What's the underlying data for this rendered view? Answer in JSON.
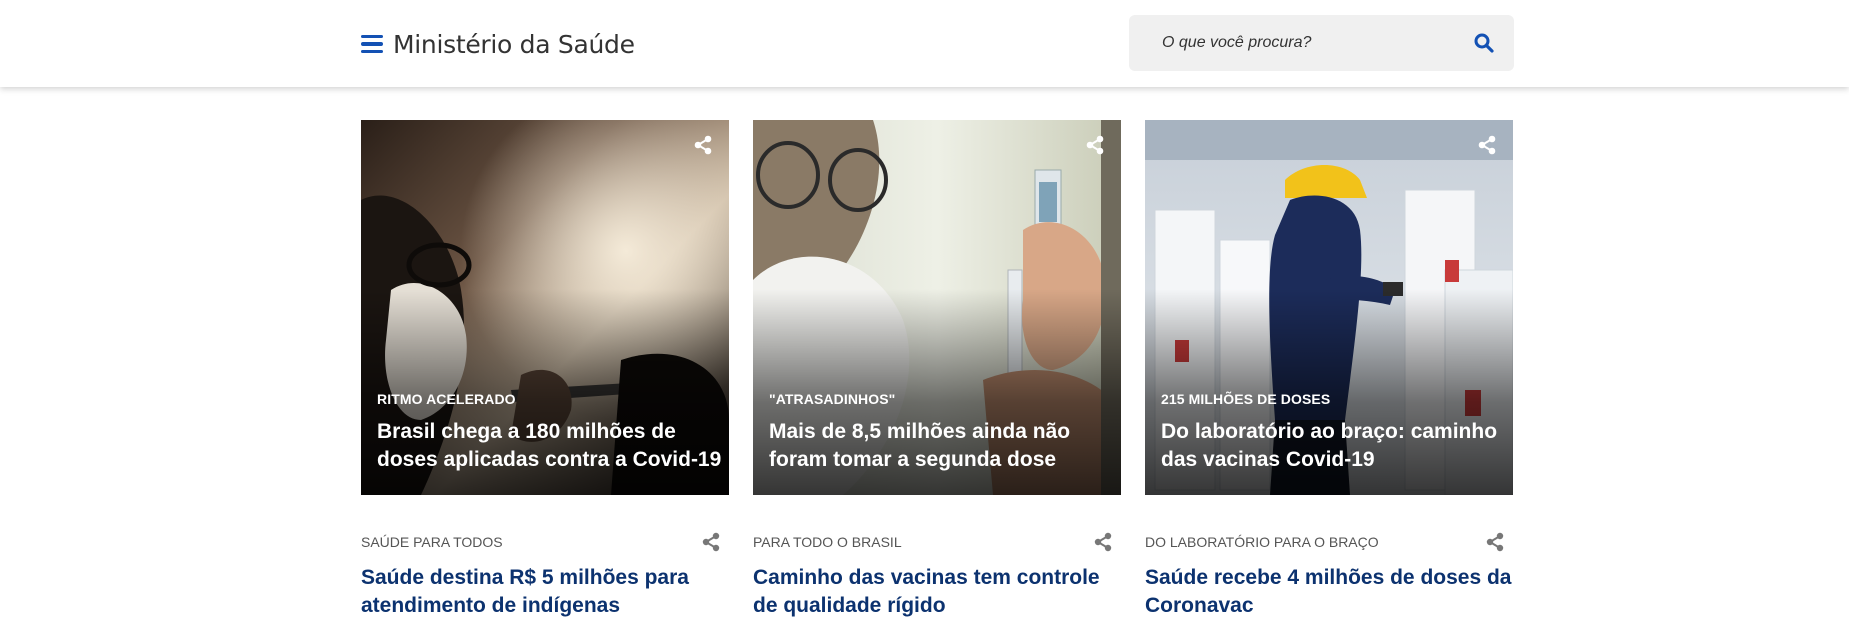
{
  "header": {
    "site_title": "Ministério da Saúde",
    "search_placeholder": "O que você procura?"
  },
  "featured": [
    {
      "kicker": "RITMO ACELERADO",
      "headline": "Brasil chega a 180 milhões de doses aplicadas contra a Covid-19"
    },
    {
      "kicker": "\"ATRASADINHOS\"",
      "headline": "Mais de 8,5 milhões ainda não foram tomar a segunda dose"
    },
    {
      "kicker": "215 MILHÕES DE DOSES",
      "headline": "Do laboratório ao braço: caminho das vacinas Covid-19"
    }
  ],
  "news": [
    {
      "kicker": "SAÚDE PARA TODOS",
      "headline": "Saúde destina R$ 5 milhões para atendimento de indígenas"
    },
    {
      "kicker": "PARA TODO O BRASIL",
      "headline": "Caminho das vacinas tem controle de qualidade rígido"
    },
    {
      "kicker": "DO LABORATÓRIO PARA O BRAÇO",
      "headline": "Saúde recebe 4 milhões de doses da Coronavac"
    }
  ],
  "colors": {
    "brand_blue": "#1351b4",
    "headline_blue": "#0c326f",
    "search_bg": "#f0f0f0"
  },
  "icons": {
    "menu": "hamburger-menu-icon",
    "search": "search-icon",
    "share": "share-icon"
  }
}
